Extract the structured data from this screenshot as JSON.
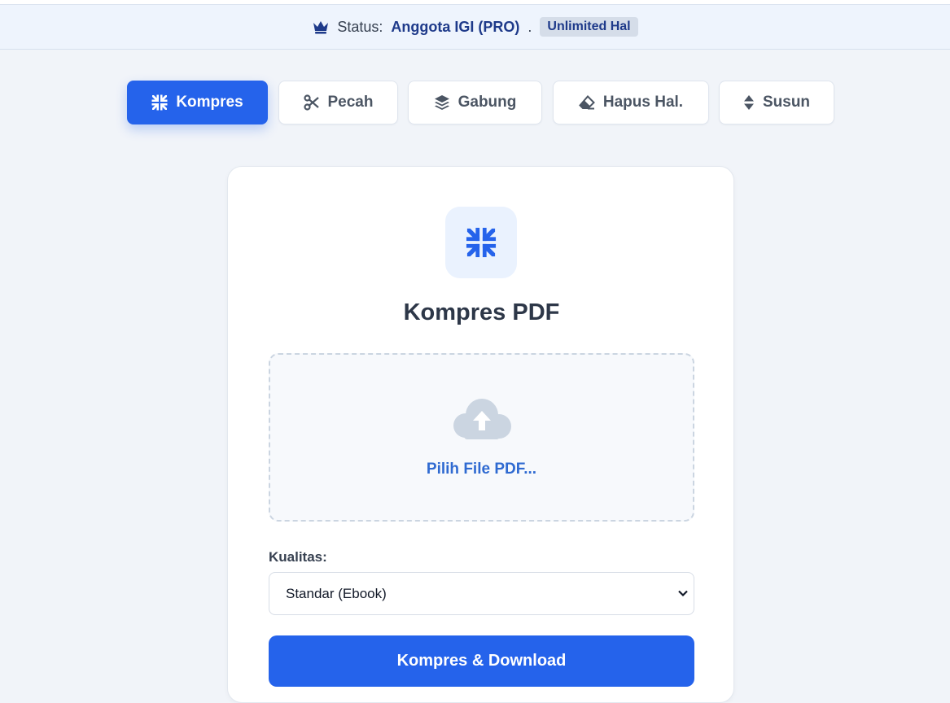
{
  "status_bar": {
    "icon": "crown-icon",
    "label": "Status:",
    "member": "Anggota IGI (PRO)",
    "separator": ".",
    "badge": "Unlimited Hal"
  },
  "tabs": [
    {
      "label": "Kompres",
      "icon": "compress-icon",
      "active": true
    },
    {
      "label": "Pecah",
      "icon": "scissors-icon",
      "active": false
    },
    {
      "label": "Gabung",
      "icon": "layers-icon",
      "active": false
    },
    {
      "label": "Hapus Hal.",
      "icon": "eraser-icon",
      "active": false
    },
    {
      "label": "Susun",
      "icon": "sort-icon",
      "active": false
    }
  ],
  "card": {
    "icon": "compress-icon",
    "title": "Kompres PDF",
    "dropzone": {
      "icon": "cloud-upload-icon",
      "label": "Pilih File PDF..."
    },
    "quality": {
      "label": "Kualitas:",
      "selected": "Standar (Ebook)"
    },
    "submit_label": "Kompres & Download"
  },
  "colors": {
    "accent": "#2563eb",
    "page_bg": "#f1f4f9",
    "status_bg": "#eef4fd",
    "title_text": "#2d3748",
    "badge_bg": "#d5dde9"
  }
}
